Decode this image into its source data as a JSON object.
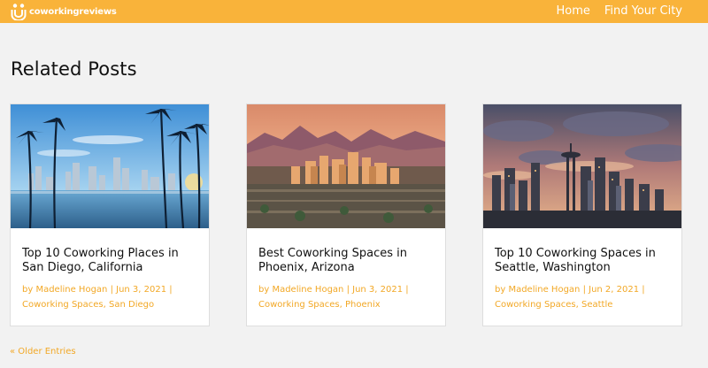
{
  "header": {
    "logo_text": "coworkingreviews",
    "nav": [
      {
        "label": "Home"
      },
      {
        "label": "Find Your City"
      }
    ],
    "colors": {
      "brand": "#f9b33a",
      "link": "#f2a826"
    }
  },
  "main": {
    "heading": "Related Posts",
    "posts": [
      {
        "title": "Top 10 Coworking Places in San Diego, California",
        "by": "by",
        "author": "Madeline Hogan",
        "date": "Jun 3, 2021",
        "categories": [
          "Coworking Spaces",
          "San Diego"
        ]
      },
      {
        "title": "Best Coworking Spaces in Phoenix, Arizona",
        "by": "by",
        "author": "Madeline Hogan",
        "date": "Jun 3, 2021",
        "categories": [
          "Coworking Spaces",
          "Phoenix"
        ]
      },
      {
        "title": "Top 10 Coworking Spaces in Seattle, Washington",
        "by": "by",
        "author": "Madeline Hogan",
        "date": "Jun 2, 2021",
        "categories": [
          "Coworking Spaces",
          "Seattle"
        ]
      }
    ],
    "older_entries": "« Older Entries"
  }
}
